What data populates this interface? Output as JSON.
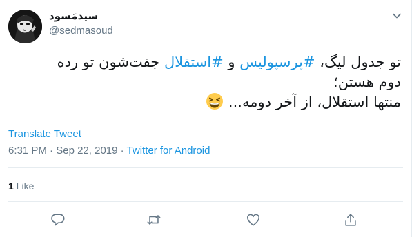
{
  "user": {
    "display_name": "سیدمَسود",
    "handle": "@sedmasoud"
  },
  "tweet": {
    "line1_prefix": "تو جدول لیگ، ",
    "hashtag1": "#پرسپولیس",
    "line1_mid": " و ",
    "hashtag2": "#استقلال",
    "line1_suffix": " جفت‌شون تو رده",
    "line2": "دوم هستن؛",
    "line3": "منتها استقلال، از آخر دومه... ",
    "emoji": "grinning-squinting-face-icon"
  },
  "translate_label": "Translate Tweet",
  "meta": {
    "time": "6:31 PM",
    "sep1": " · ",
    "date": "Sep 22, 2019",
    "sep2": " · ",
    "source": "Twitter for Android"
  },
  "likes": {
    "count": "1",
    "label": " Like"
  },
  "colors": {
    "link": "#1b95e0",
    "secondary": "#657786",
    "border": "#e6ecf0",
    "emoji": "#ffcc4d"
  },
  "actions": [
    "reply-icon",
    "retweet-icon",
    "like-icon",
    "share-icon"
  ]
}
